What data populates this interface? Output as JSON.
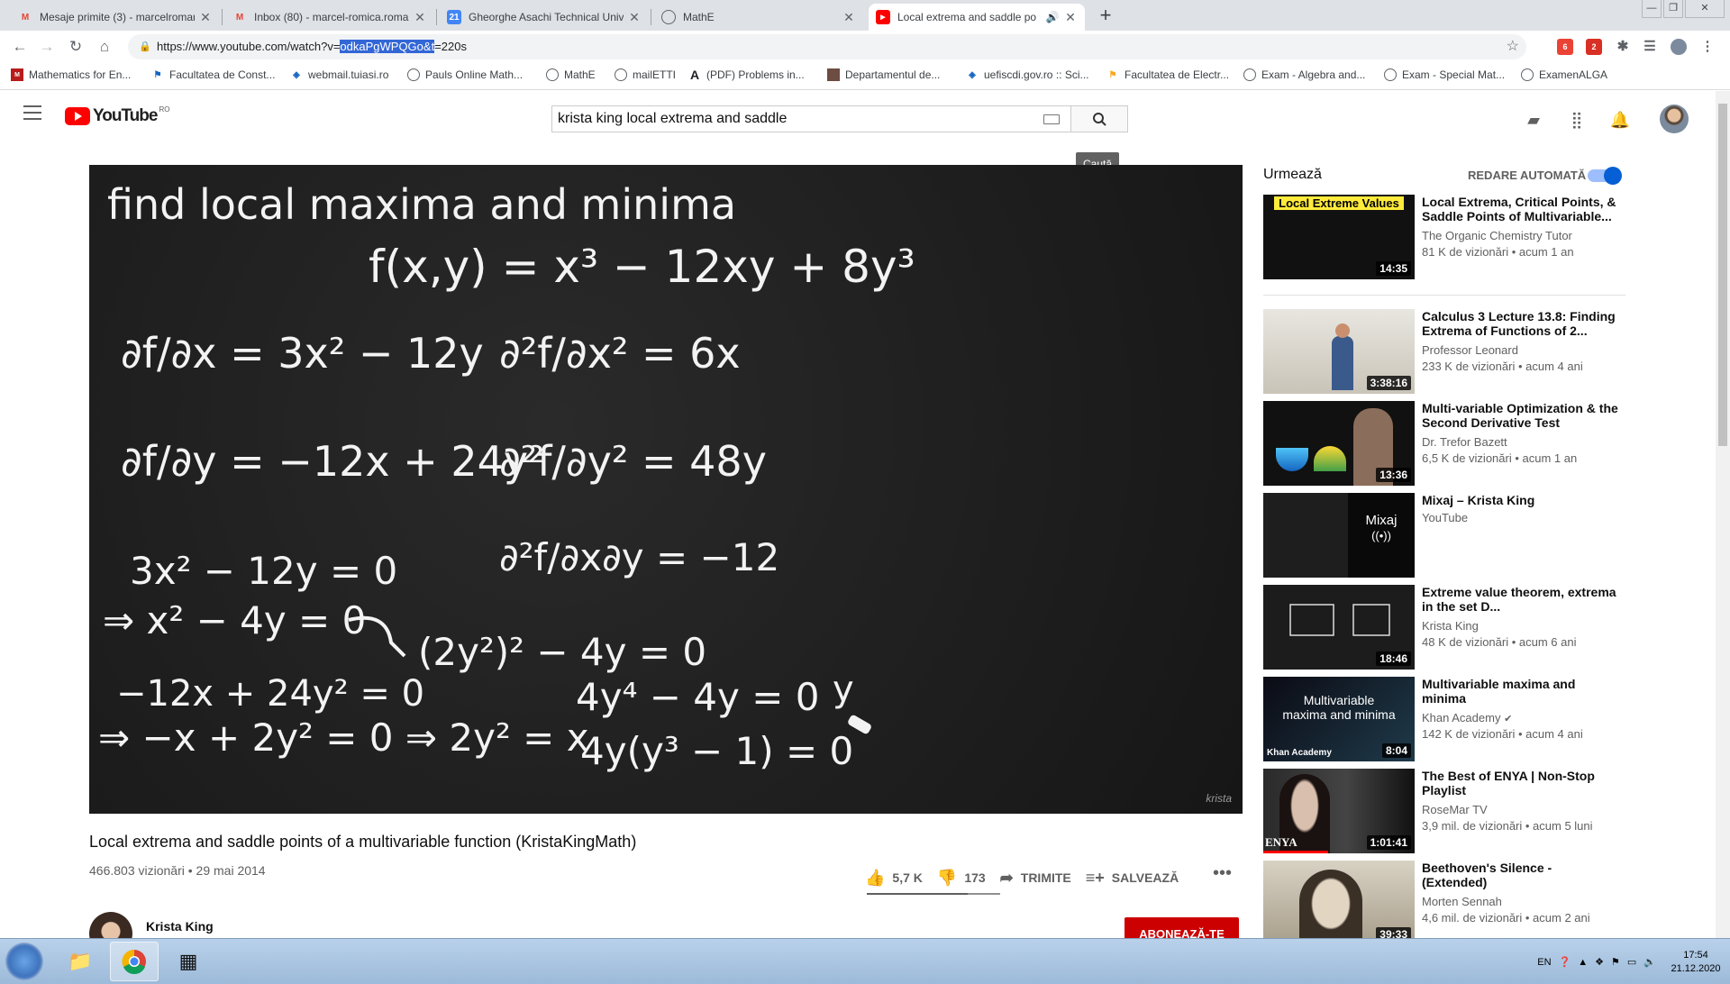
{
  "browser": {
    "tabs": [
      {
        "title": "Mesaje primite (3) - marcelromar",
        "icon": "gmail-icon",
        "color": "#ea4335",
        "active": false
      },
      {
        "title": "Inbox (80) - marcel-romica.roma",
        "icon": "gmail-icon",
        "color": "#ea4335",
        "active": false
      },
      {
        "title": "Gheorghe Asachi Technical Unive",
        "icon": "calendar-icon",
        "color": "#4285f4",
        "active": false
      },
      {
        "title": "MathE",
        "icon": "globe-icon",
        "color": "#5f6368",
        "active": false
      },
      {
        "title": "Local extrema and saddle po",
        "icon": "youtube-icon",
        "color": "#ff0000",
        "active": true
      }
    ],
    "url_prefix": "https://www.youtube.com/watch?v=",
    "url_selected": "odkaPgWPQGo&t",
    "url_suffix": "=220s",
    "bookmarks": [
      {
        "label": "Mathematics for En...",
        "icon": "book-icon"
      },
      {
        "label": "Facultatea de Const...",
        "icon": "building-icon"
      },
      {
        "label": "webmail.tuiasi.ro",
        "icon": "shield-icon"
      },
      {
        "label": "Pauls Online Math...",
        "icon": "globe-icon"
      },
      {
        "label": "MathE",
        "icon": "globe-icon"
      },
      {
        "label": "mailETTI",
        "icon": "globe-icon"
      },
      {
        "label": "(PDF) Problems in...",
        "icon": "a-icon"
      },
      {
        "label": "Departamentul de...",
        "icon": "dept-icon"
      },
      {
        "label": "uefiscdi.gov.ro :: Sci...",
        "icon": "shield-icon"
      },
      {
        "label": "Facultatea de Electr...",
        "icon": "building-icon"
      },
      {
        "label": "Exam - Algebra and...",
        "icon": "globe-icon"
      },
      {
        "label": "Exam - Special Mat...",
        "icon": "globe-icon"
      },
      {
        "label": "ExamenALGA",
        "icon": "globe-icon"
      }
    ],
    "ext_badges": [
      "6",
      "2"
    ]
  },
  "youtube": {
    "logo": "YouTube",
    "country": "RO",
    "search_query": "krista king local extrema and saddle",
    "search_tooltip": "Caută",
    "video": {
      "title": "Local extrema and saddle points of a multivariable function (KristaKingMath)",
      "meta": "466.803 vizionări • 29 mai 2014",
      "likes": "5,7 K",
      "dislikes": "173",
      "like_ratio": 0.76,
      "share": "TRIMITE",
      "save": "SALVEAZĂ",
      "channel": "Krista King",
      "subscribe": "ABONEAZĂ-TE",
      "watermark": "krista",
      "board": {
        "heading": "find local maxima and minima",
        "function": "f(x,y) = x³ − 12xy + 8y³",
        "fx": "∂f/∂x = 3x² − 12y",
        "fxx": "∂²f/∂x² = 6x",
        "fy": "∂f/∂y = −12x + 24y²",
        "fyy": "∂²f/∂y² = 48y",
        "fxy": "∂²f/∂x∂y = −12",
        "s1": "3x² − 12y = 0",
        "s2": "⇒ x² − 4y = 0",
        "s3": "(2y²)² − 4y = 0",
        "s4": "−12x + 24y² = 0",
        "s5": "4y⁴ − 4y = 0",
        "s6": "⇒ −x + 2y² = 0 ⇒ 2y² = x",
        "s7": "4y(y³ − 1) = 0",
        "s8": "y"
      }
    },
    "sidebar": {
      "up_next": "Urmează",
      "autoplay": "REDARE AUTOMATĂ",
      "items": [
        {
          "title": "Local Extrema, Critical Points, & Saddle Points of Multivariable...",
          "channel": "The Organic Chemistry Tutor",
          "views": "81 K de vizionări • acum 1 an",
          "duration": "14:35",
          "thumb_text": "Local Extreme Values"
        },
        {
          "title": "Calculus 3 Lecture 13.8: Finding Extrema of Functions of 2...",
          "channel": "Professor Leonard",
          "views": "233 K de vizionări • acum 4 ani",
          "duration": "3:38:16"
        },
        {
          "title": "Multi-variable Optimization & the Second Derivative Test",
          "channel": "Dr. Trefor Bazett",
          "views": "6,5 K de vizionări • acum 1 an",
          "duration": "13:36"
        },
        {
          "title": "Mixaj – Krista King",
          "channel": "YouTube",
          "views": "",
          "duration": "",
          "overlay": "Mixaj"
        },
        {
          "title": "Extreme value theorem, extrema in the set D...",
          "channel": "Krista King",
          "views": "48 K de vizionări • acum 6 ani",
          "duration": "18:46"
        },
        {
          "title": "Multivariable maxima and minima",
          "channel": "Khan Academy",
          "views": "142 K de vizionări • acum 4 ani",
          "duration": "8:04",
          "thumb_text": "Multivariable maxima and minima",
          "thumb_brand": "Khan Academy"
        },
        {
          "title": "The Best of ENYA | Non-Stop Playlist",
          "channel": "RoseMar TV",
          "views": "3,9 mil. de vizionări • acum 5 luni",
          "duration": "1:01:41",
          "thumb_text": "ENYA"
        },
        {
          "title": "Beethoven's Silence - (Extended)",
          "channel": "Morten Sennah",
          "views": "4,6 mil. de vizionări • acum 2 ani",
          "duration": "39:33"
        }
      ]
    }
  },
  "taskbar": {
    "lang": "EN",
    "time": "17:54",
    "date": "21.12.2020"
  }
}
